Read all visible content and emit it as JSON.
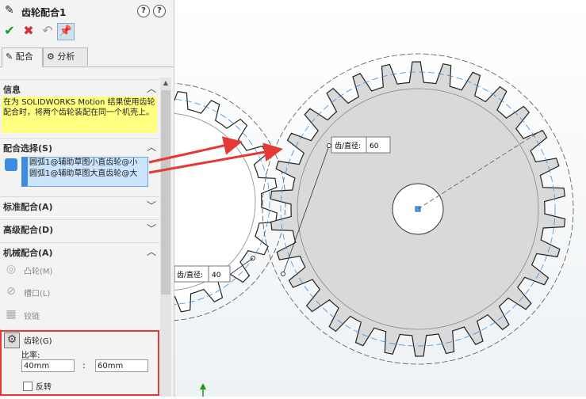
{
  "feature": {
    "title": "齿轮配合1"
  },
  "help_icons": [
    "?",
    "?"
  ],
  "tabs": [
    {
      "label": "配合"
    },
    {
      "label": "分析"
    }
  ],
  "sections": {
    "info": {
      "label": "信息",
      "text": "在为 SOLIDWORKS Motion 结果使用齿轮配合时，将两个齿轮装配在同一个机壳上。"
    },
    "selection": {
      "label": "配合选择(S)",
      "items": [
        "圆弧1@辅助草图小直齿轮@小",
        "圆弧1@辅助草图大直齿轮@大"
      ]
    },
    "standard": {
      "label": "标准配合(A)"
    },
    "advanced": {
      "label": "高级配合(D)"
    },
    "mechanical": {
      "label": "机械配合(A)"
    }
  },
  "mechanical_mates": [
    {
      "label": "凸轮(M)",
      "icon": "cam-icon"
    },
    {
      "label": "槽口(L)",
      "icon": "slot-icon"
    },
    {
      "label": "铰链",
      "icon": "hinge-icon"
    },
    {
      "label": "齿轮(G)",
      "icon": "gear-icon"
    }
  ],
  "gear": {
    "ratio_label": "比率:",
    "ratio_left": "40mm",
    "ratio_sep": ":",
    "ratio_right": "60mm",
    "reverse_label": "反转"
  },
  "viewport": {
    "dim_large": {
      "label": "齿/直径:",
      "value": "60"
    },
    "dim_small": {
      "label": "齿/直径:",
      "value": "40"
    }
  },
  "colors": {
    "accent": "#3c8de0",
    "arrow": "#e53935",
    "info_bg": "#ffff80",
    "gear_fill": "#d9d9d9"
  }
}
